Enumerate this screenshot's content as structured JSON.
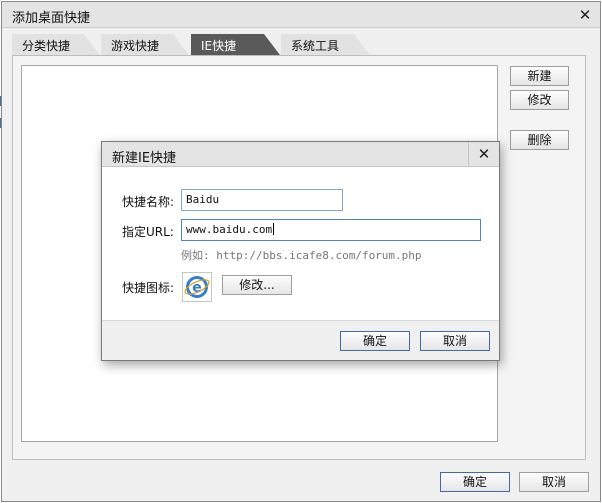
{
  "window": {
    "title": "添加桌面快捷"
  },
  "tabs": [
    {
      "label": "分类快捷",
      "active": false
    },
    {
      "label": "游戏快捷",
      "active": false
    },
    {
      "label": "IE快捷",
      "active": true
    },
    {
      "label": "系统工具",
      "active": false
    }
  ],
  "side_buttons": {
    "new": "新建",
    "edit": "修改",
    "delete": "删除"
  },
  "footer": {
    "ok": "确定",
    "cancel": "取消"
  },
  "subdialog": {
    "title": "新建IE快捷",
    "name_label": "快捷名称:",
    "name_value": "Baidu",
    "url_label": "指定URL:",
    "url_value": "www.baidu.com",
    "url_hint": "例如: http://bbs.icafe8.com/forum.php",
    "icon_label": "快捷图标:",
    "icon_name": "ie-icon",
    "edit_icon_button": "修改...",
    "ok": "确定",
    "cancel": "取消"
  },
  "colors": {
    "accent": "#3d6ca8",
    "active_tab": "#5a5a5a",
    "ie_blue": "#2b7fd4"
  }
}
